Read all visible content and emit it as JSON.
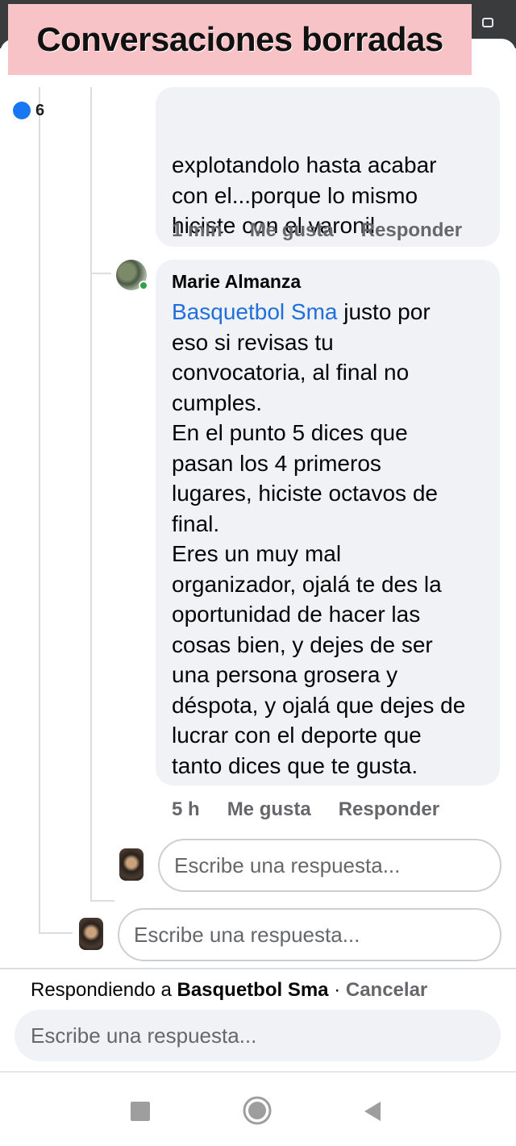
{
  "banner": {
    "title": "Conversaciones borradas"
  },
  "header": {
    "count": "6"
  },
  "comments": [
    {
      "text_visible": "explotandolo hasta acabar\ncon el...porque lo mismo\nhiciste con el varonil",
      "time": "1 min",
      "like": "Me gusta",
      "reply": "Responder"
    },
    {
      "author": "Marie Almanza",
      "mention": "Basquetbol Sma",
      "text": " justo por\neso  si revisas tu\nconvocatoria, al final no\ncumples.\nEn el punto 5 dices que\npasan los 4 primeros\nlugares, hiciste octavos de\nfinal.\nEres un muy mal\norganizador, ojalá te des la\noportunidad de hacer las\ncosas bien, y dejes de ser\nuna persona grosera y\ndéspota, y ojalá que dejes de\nlucrar con el deporte que\ntanto dices que te gusta.",
      "time": "5 h",
      "like": "Me gusta",
      "reply": "Responder"
    }
  ],
  "reply_inputs": {
    "nested_placeholder": "Escribe una respuesta...",
    "thread_placeholder": "Escribe una respuesta..."
  },
  "replying_bar": {
    "prefix": "Respondiendo a ",
    "name": "Basquetbol Sma",
    "separator": " · ",
    "cancel": "Cancelar"
  },
  "composer": {
    "placeholder": "Escribe una respuesta..."
  },
  "icons": {
    "like": "thumbs-up-icon",
    "recent_apps": "square-icon",
    "home": "circle-home-icon",
    "back": "triangle-back-icon"
  },
  "colors": {
    "banner_bg": "#f8c3c7",
    "mention": "#216fdb",
    "bubble": "#f0f2f5",
    "meta": "#65676b"
  }
}
